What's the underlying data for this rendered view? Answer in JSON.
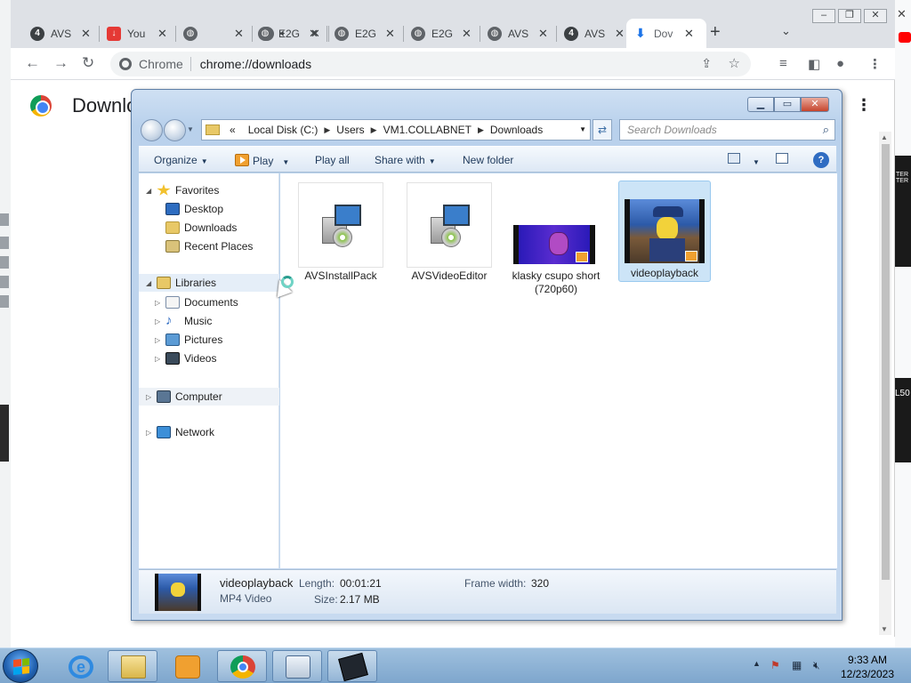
{
  "browser": {
    "tabs": [
      {
        "title": "AVS",
        "favicon": "avs-icon",
        "fav_color": "#3c4043"
      },
      {
        "title": "You",
        "favicon": "download-app-icon",
        "fav_color": "#e53935"
      },
      {
        "title": "",
        "favicon": "globe-icon",
        "fav_color": "#5f6368"
      },
      {
        "title": "",
        "favicon": "globe-icon",
        "fav_color": "#5f6368",
        "audio": true
      },
      {
        "title": "E2G",
        "favicon": "globe-icon",
        "fav_color": "#5f6368"
      },
      {
        "title": "E2G",
        "favicon": "globe-icon",
        "fav_color": "#5f6368"
      },
      {
        "title": "E2G",
        "favicon": "globe-icon",
        "fav_color": "#5f6368"
      },
      {
        "title": "AVS",
        "favicon": "globe-icon",
        "fav_color": "#5f6368"
      },
      {
        "title": "AVS",
        "favicon": "avs-icon",
        "fav_color": "#3c4043"
      },
      {
        "title": "Dov",
        "favicon": "download-icon",
        "fav_color": "#1a73e8",
        "active": true
      }
    ],
    "new_tab": "+",
    "tab_search": "⌄",
    "address": {
      "site": "Chrome",
      "url": "chrome://downloads"
    },
    "page_title": "Downlo"
  },
  "explorer": {
    "breadcrumb": [
      "«",
      "Local Disk (C:)",
      "Users",
      "VM1.COLLABNET",
      "Downloads"
    ],
    "search_placeholder": "Search Downloads",
    "commands": {
      "organize": "Organize",
      "play": "Play",
      "play_all": "Play all",
      "share_with": "Share with",
      "new_folder": "New folder"
    },
    "nav": {
      "favorites": "Favorites",
      "desktop": "Desktop",
      "downloads": "Downloads",
      "recent_places": "Recent Places",
      "libraries": "Libraries",
      "documents": "Documents",
      "music": "Music",
      "pictures": "Pictures",
      "videos": "Videos",
      "computer": "Computer",
      "network": "Network"
    },
    "files": [
      {
        "name": "AVSInstallPack",
        "type": "installer"
      },
      {
        "name": "AVSVideoEditor",
        "type": "installer"
      },
      {
        "name": "klasky csupo short (720p60)",
        "type": "video"
      },
      {
        "name": "videoplayback",
        "type": "video",
        "selected": true
      }
    ],
    "details": {
      "name": "videoplayback",
      "type": "MP4 Video",
      "length_label": "Length:",
      "length": "00:01:21",
      "size_label": "Size:",
      "size": "2.17 MB",
      "frame_width_label": "Frame width:",
      "frame_width": "320"
    }
  },
  "taskbar": {
    "clock_time": "9:33 AM",
    "clock_date": "12/23/2023"
  },
  "edge_text": {
    "right_mid": "L50",
    "right_top": "TER TER"
  }
}
